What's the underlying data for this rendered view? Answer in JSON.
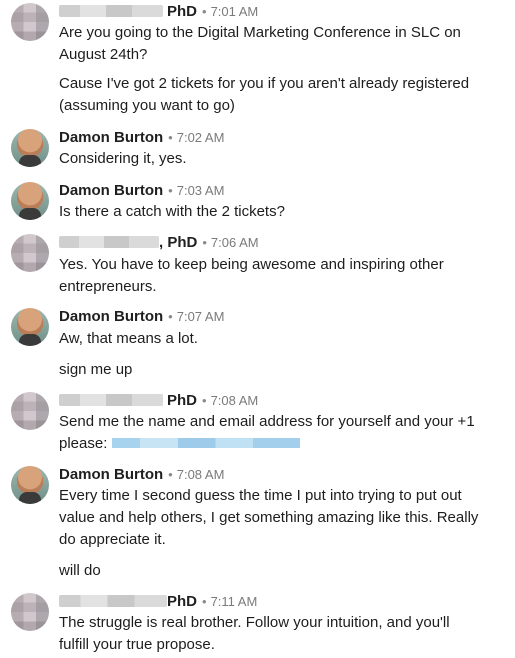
{
  "messages": [
    {
      "id": "m1",
      "sender_suffix": "PhD",
      "sender_redacted": true,
      "time": "7:01 AM",
      "avatar": "pixelated",
      "lines": [
        "Are you going to the Digital Marketing Conference in SLC on",
        "August 24th?",
        "Cause I've got 2 tickets for you if you aren't already registered",
        "(assuming you want to go)"
      ]
    },
    {
      "id": "m2",
      "sender": "Damon Burton",
      "time": "7:02 AM",
      "avatar": "photo",
      "lines": [
        "Considering it, yes."
      ]
    },
    {
      "id": "m3",
      "sender": "Damon Burton",
      "time": "7:03 AM",
      "avatar": "photo",
      "lines": [
        "Is there a catch with the 2 tickets?"
      ]
    },
    {
      "id": "m4",
      "sender_suffix": ", PhD",
      "sender_redacted": true,
      "time": "7:06 AM",
      "avatar": "pixelated",
      "lines": [
        "Yes. You have to keep being awesome and inspiring other",
        "entrepreneurs."
      ]
    },
    {
      "id": "m5",
      "sender": "Damon Burton",
      "time": "7:07 AM",
      "avatar": "photo",
      "lines": [
        "Aw, that means a lot.",
        "sign me up"
      ]
    },
    {
      "id": "m6",
      "sender_suffix": "PhD",
      "sender_redacted": true,
      "time": "7:08 AM",
      "avatar": "pixelated",
      "lines": [
        "Send me the name and email address for yourself and your +1",
        "please:"
      ],
      "redacted_link": true
    },
    {
      "id": "m7",
      "sender": "Damon Burton",
      "time": "7:08 AM",
      "avatar": "photo",
      "lines": [
        "Every time I second guess the time I put into trying to put out",
        "value and help others, I get something amazing like this. Really",
        "do appreciate it.",
        "will do"
      ]
    },
    {
      "id": "m8",
      "sender_suffix": "PhD",
      "sender_redacted": true,
      "time": "7:11 AM",
      "avatar": "pixelated",
      "lines": [
        "The struggle is real brother. Follow your intuition, and you'll",
        "fulfill your true propose."
      ]
    }
  ],
  "separator": "•",
  "colors": {
    "text": "#1d1d1d",
    "timestamp": "#7a7a7a",
    "link_redacted": "#a8d3ee"
  }
}
